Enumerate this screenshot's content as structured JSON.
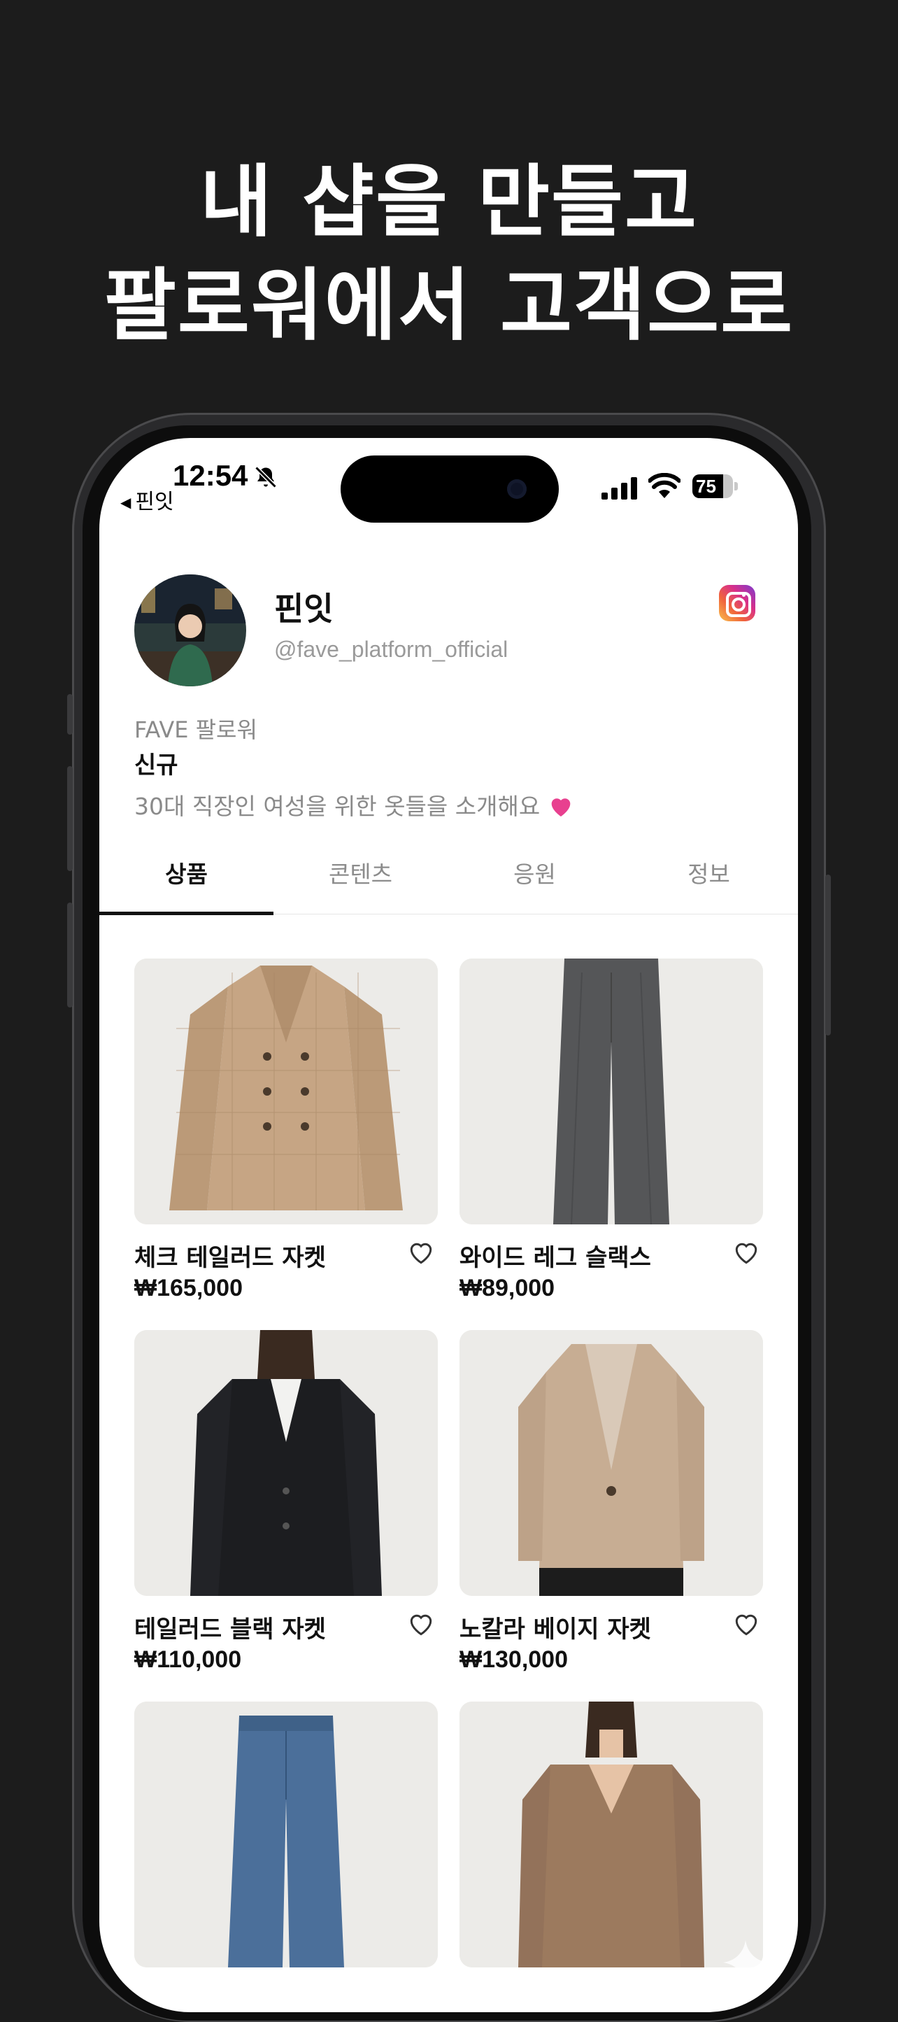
{
  "headline": {
    "line1": "내 샵을 만들고",
    "line2": "팔로워에서 고객으로"
  },
  "status_bar": {
    "time": "12:54",
    "back_app": "핀잇",
    "battery": "75"
  },
  "profile": {
    "name": "핀잇",
    "handle": "@fave_platform_official",
    "follower_label": "FAVE 팔로워",
    "follower_value": "신규",
    "bio": "30대 직장인 여성을 위한 옷들을 소개해요"
  },
  "tabs": [
    "상품",
    "콘텐츠",
    "응원",
    "정보"
  ],
  "products": [
    {
      "name": "체크 테일러드 자켓",
      "price": "₩165,000",
      "icon": "check-jacket"
    },
    {
      "name": "와이드 레그 슬랙스",
      "price": "₩89,000",
      "icon": "gray-slacks"
    },
    {
      "name": "테일러드 블랙 자켓",
      "price": "₩110,000",
      "icon": "black-jacket"
    },
    {
      "name": "노칼라 베이지 자켓",
      "price": "₩130,000",
      "icon": "beige-jacket"
    },
    {
      "name": "",
      "price": "",
      "icon": "denim-jeans"
    },
    {
      "name": "",
      "price": "",
      "icon": "brown-sweater"
    }
  ],
  "colors": {
    "background": "#1c1c1c",
    "accent": "#111111",
    "heart": "#e8408f"
  }
}
